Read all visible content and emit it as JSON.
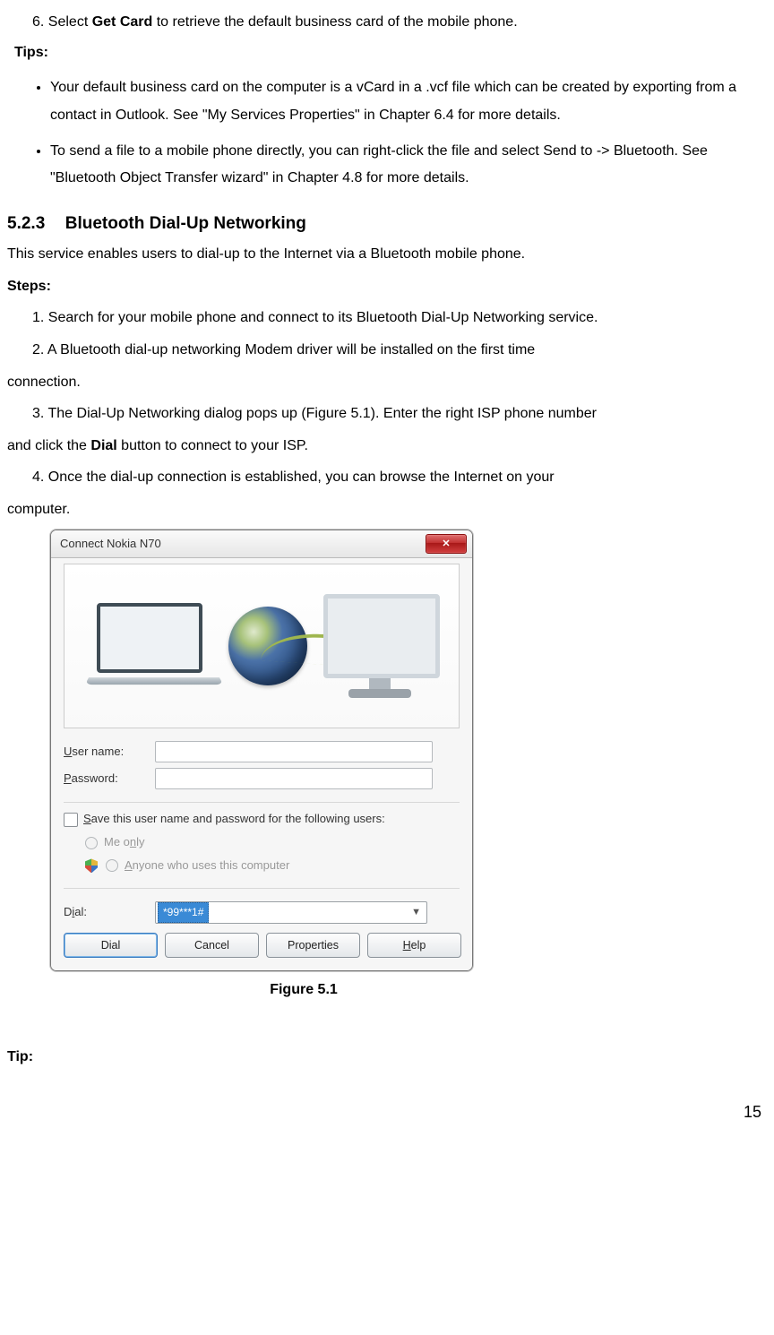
{
  "topStep": {
    "prefix": "6. Select ",
    "bold": "Get Card",
    "suffix": " to retrieve the default business card of the mobile phone."
  },
  "tipsLabel": "Tips:",
  "tipsBullets": [
    "Your default business card on the computer is a vCard in a .vcf file which can be created by exporting from a contact in Outlook. See \"My Services Properties\" in Chapter 6.4 for more details.",
    "To send a file to a mobile phone directly, you can right-click the file and select Send to -> Bluetooth. See \"Bluetooth Object Transfer wizard\" in Chapter 4.8 for more details."
  ],
  "section": {
    "num": "5.2.3",
    "title": "Bluetooth Dial-Up Networking"
  },
  "sectionIntro": "This service enables users to dial-up to the Internet via a Bluetooth mobile phone.",
  "stepsLabel": "Steps:",
  "steps": {
    "s1": "1. Search for your mobile phone and connect to its Bluetooth Dial-Up Networking service.",
    "s2a": "2. A Bluetooth dial-up networking Modem driver will be installed on the first time",
    "s2b": "connection.",
    "s3a_prefix": "3. The Dial-Up Networking dialog pops up (Figure 5.1). Enter the right ISP phone number",
    "s3b_prefix": "and click the ",
    "s3b_bold": "Dial",
    "s3b_suffix": " button to connect to your ISP.",
    "s4a": "4. Once the dial-up connection is established, you can browse the Internet on your",
    "s4b": "computer."
  },
  "dialog": {
    "title": "Connect Nokia N70",
    "usernameLabelPre": "U",
    "usernameLabelRest": "ser name:",
    "passwordLabelPre": "P",
    "passwordLabelRest": "assword:",
    "saveLabelPre": "S",
    "saveLabelRest": "ave this user name and password for the following users:",
    "meOnlyPre": "Me o",
    "meOnlyU": "n",
    "meOnlyRest": "ly",
    "anyonePre": "A",
    "anyoneRest": "nyone who uses this computer",
    "dialLabelPre": "D",
    "dialLabelU": "i",
    "dialLabelRest": "al:",
    "dialValue": "*99***1#",
    "btnDial": "Dial",
    "btnCancel": "Cancel",
    "btnProperties": "Properties",
    "btnHelpPre": "H",
    "btnHelpRest": "elp",
    "usernameValue": "",
    "passwordValue": ""
  },
  "figureCaption": "Figure 5.1",
  "tipLabel": "Tip:",
  "pageNumber": "15"
}
